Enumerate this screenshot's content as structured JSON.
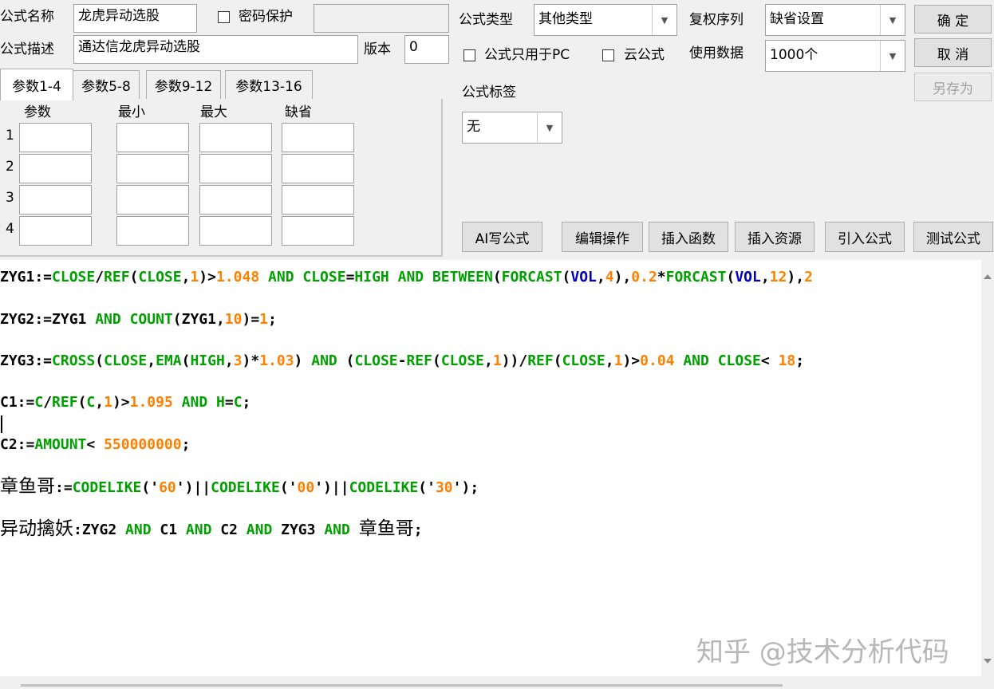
{
  "form": {
    "name_label": "公式名称",
    "name_value": "龙虎异动选股",
    "password_label": "密码保护",
    "password_value": "",
    "desc_label": "公式描述",
    "desc_value": "通达信龙虎异动选股",
    "version_label": "版本",
    "version_value": "0"
  },
  "tabs": [
    "参数1-4",
    "参数5-8",
    "参数9-12",
    "参数13-16"
  ],
  "params": {
    "headers": [
      "参数",
      "最小",
      "最大",
      "缺省"
    ],
    "rows": [
      "1",
      "2",
      "3",
      "4"
    ]
  },
  "right": {
    "type_label": "公式类型",
    "type_value": "其他类型",
    "rights_label": "复权序列",
    "rights_value": "缺省设置",
    "pc_only_label": "公式只用于PC",
    "cloud_label": "云公式",
    "data_label": "使用数据",
    "data_value": "1000个",
    "tag_label": "公式标签",
    "tag_value": "无"
  },
  "buttons": {
    "ok": "确  定",
    "cancel": "取  消",
    "save_as": "另存为",
    "ai": "AI写公式",
    "edit": "编辑操作",
    "insert_func": "插入函数",
    "insert_res": "插入资源",
    "import": "引入公式",
    "test": "测试公式"
  },
  "colors": {
    "keyword": "#00a000",
    "function": "#00a000",
    "number": "#ff8000",
    "variable": "#0000c0",
    "text": "#000000"
  },
  "code": [
    [
      [
        "t",
        "ZYG1:="
      ],
      [
        "f",
        "CLOSE"
      ],
      [
        "t",
        "/"
      ],
      [
        "f",
        "REF"
      ],
      [
        "t",
        "("
      ],
      [
        "f",
        "CLOSE"
      ],
      [
        "t",
        ","
      ],
      [
        "n",
        "1"
      ],
      [
        "t",
        ")>"
      ],
      [
        "n",
        "1.048"
      ],
      [
        "t",
        " "
      ],
      [
        "k",
        "AND"
      ],
      [
        "t",
        " "
      ],
      [
        "f",
        "CLOSE"
      ],
      [
        "t",
        "="
      ],
      [
        "f",
        "HIGH"
      ],
      [
        "t",
        " "
      ],
      [
        "k",
        "AND"
      ],
      [
        "t",
        " "
      ],
      [
        "f",
        "BETWEEN"
      ],
      [
        "t",
        "("
      ],
      [
        "f",
        "FORCAST"
      ],
      [
        "t",
        "("
      ],
      [
        "v",
        "VOL"
      ],
      [
        "t",
        ","
      ],
      [
        "n",
        "4"
      ],
      [
        "t",
        "),"
      ],
      [
        "n",
        "0.2"
      ],
      [
        "t",
        "*"
      ],
      [
        "f",
        "FORCAST"
      ],
      [
        "t",
        "("
      ],
      [
        "v",
        "VOL"
      ],
      [
        "t",
        ","
      ],
      [
        "n",
        "12"
      ],
      [
        "t",
        "),"
      ],
      [
        "n",
        "2"
      ]
    ],
    [
      [
        "t",
        "ZYG2:=ZYG1 "
      ],
      [
        "k",
        "AND"
      ],
      [
        "t",
        " "
      ],
      [
        "f",
        "COUNT"
      ],
      [
        "t",
        "(ZYG1,"
      ],
      [
        "n",
        "10"
      ],
      [
        "t",
        ")="
      ],
      [
        "n",
        "1"
      ],
      [
        "t",
        ";"
      ]
    ],
    [
      [
        "t",
        "ZYG3:="
      ],
      [
        "f",
        "CROSS"
      ],
      [
        "t",
        "("
      ],
      [
        "f",
        "CLOSE"
      ],
      [
        "t",
        ","
      ],
      [
        "f",
        "EMA"
      ],
      [
        "t",
        "("
      ],
      [
        "f",
        "HIGH"
      ],
      [
        "t",
        ","
      ],
      [
        "n",
        "3"
      ],
      [
        "t",
        ")*"
      ],
      [
        "n",
        "1.03"
      ],
      [
        "t",
        ") "
      ],
      [
        "k",
        "AND"
      ],
      [
        "t",
        " ("
      ],
      [
        "f",
        "CLOSE"
      ],
      [
        "t",
        "-"
      ],
      [
        "f",
        "REF"
      ],
      [
        "t",
        "("
      ],
      [
        "f",
        "CLOSE"
      ],
      [
        "t",
        ","
      ],
      [
        "n",
        "1"
      ],
      [
        "t",
        "))/"
      ],
      [
        "f",
        "REF"
      ],
      [
        "t",
        "("
      ],
      [
        "f",
        "CLOSE"
      ],
      [
        "t",
        ","
      ],
      [
        "n",
        "1"
      ],
      [
        "t",
        ")>"
      ],
      [
        "n",
        "0.04"
      ],
      [
        "t",
        " "
      ],
      [
        "k",
        "AND"
      ],
      [
        "t",
        " "
      ],
      [
        "f",
        "CLOSE"
      ],
      [
        "t",
        "< "
      ],
      [
        "n",
        "18"
      ],
      [
        "t",
        ";"
      ]
    ],
    [
      [
        "t",
        "C1:="
      ],
      [
        "f",
        "C"
      ],
      [
        "t",
        "/"
      ],
      [
        "f",
        "REF"
      ],
      [
        "t",
        "("
      ],
      [
        "f",
        "C"
      ],
      [
        "t",
        ","
      ],
      [
        "n",
        "1"
      ],
      [
        "t",
        ")>"
      ],
      [
        "n",
        "1.095"
      ],
      [
        "t",
        " "
      ],
      [
        "k",
        "AND"
      ],
      [
        "t",
        " "
      ],
      [
        "f",
        "H"
      ],
      [
        "t",
        "="
      ],
      [
        "f",
        "C"
      ],
      [
        "t",
        ";"
      ]
    ],
    [
      [
        "t",
        "C2:="
      ],
      [
        "f",
        "AMOUNT"
      ],
      [
        "t",
        "< "
      ],
      [
        "n",
        "550000000"
      ],
      [
        "t",
        ";"
      ]
    ],
    [
      [
        "c",
        "章鱼哥"
      ],
      [
        "t",
        ":="
      ],
      [
        "f",
        "CODELIKE"
      ],
      [
        "t",
        "('"
      ],
      [
        "n",
        "60"
      ],
      [
        "t",
        "')||"
      ],
      [
        "f",
        "CODELIKE"
      ],
      [
        "t",
        "('"
      ],
      [
        "n",
        "00"
      ],
      [
        "t",
        "')||"
      ],
      [
        "f",
        "CODELIKE"
      ],
      [
        "t",
        "('"
      ],
      [
        "n",
        "30"
      ],
      [
        "t",
        "');"
      ]
    ],
    [
      [
        "c",
        "异动擒妖"
      ],
      [
        "t",
        ":ZYG2 "
      ],
      [
        "k",
        "AND"
      ],
      [
        "t",
        " C1 "
      ],
      [
        "k",
        "AND"
      ],
      [
        "t",
        " C2 "
      ],
      [
        "k",
        "AND"
      ],
      [
        "t",
        " ZYG3 "
      ],
      [
        "k",
        "AND"
      ],
      [
        "t",
        " "
      ],
      [
        "c",
        "章鱼哥"
      ],
      [
        "t",
        ";"
      ]
    ]
  ],
  "watermark": "知乎 @技术分析代码"
}
